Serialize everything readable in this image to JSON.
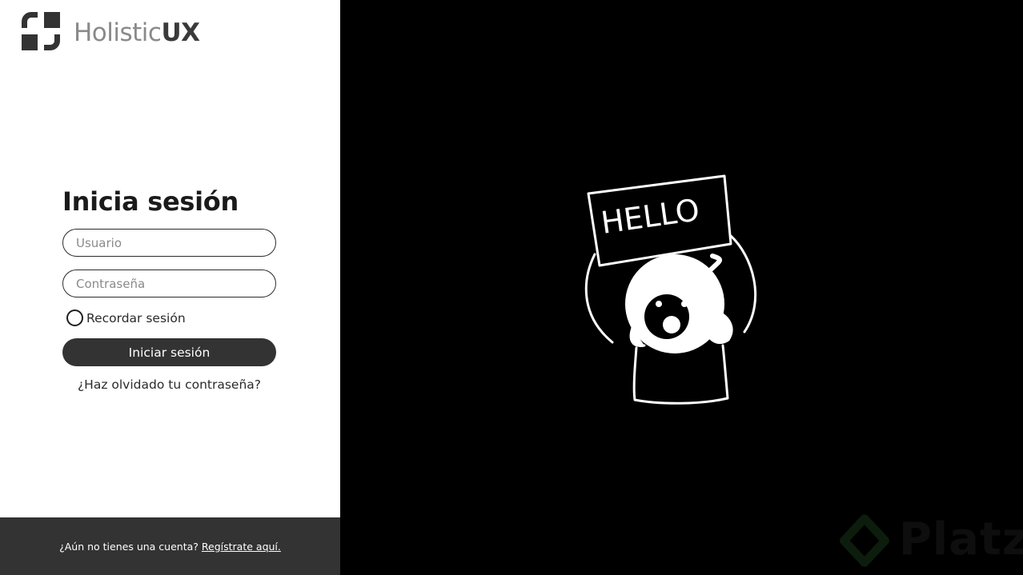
{
  "brand": {
    "logo_light": "Holistic",
    "logo_bold": "UX"
  },
  "login": {
    "title": "Inicia sesión",
    "username_placeholder": "Usuario",
    "password_placeholder": "Contraseña",
    "remember_label": "Recordar sesión",
    "submit_label": "Iniciar sesión",
    "forgot_label": "¿Haz olvidado tu contraseña?"
  },
  "footer": {
    "question": "¿Aún no tienes una cuenta?",
    "register_link": "Regístrate aquí."
  },
  "illustration": {
    "sign_text": "HELLO"
  },
  "watermark": {
    "text": "Platzi"
  },
  "colors": {
    "dark": "#333333",
    "background_right": "#000000",
    "background_left": "#ffffff"
  }
}
